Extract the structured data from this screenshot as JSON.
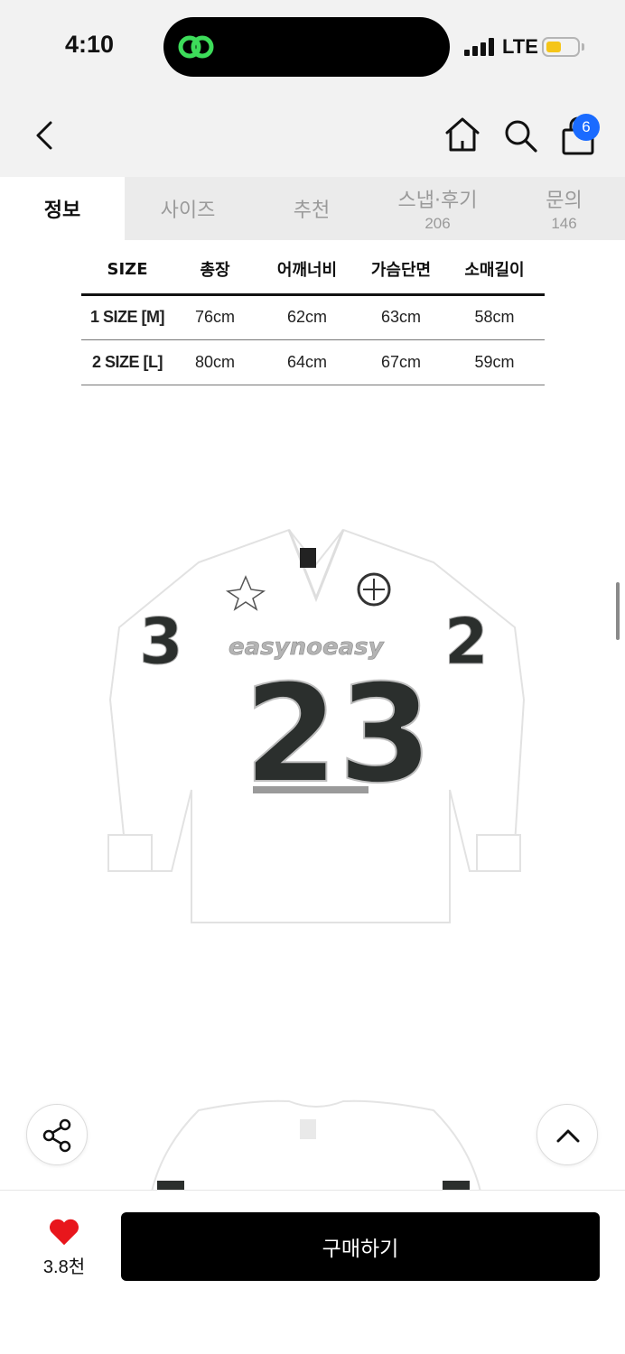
{
  "status_bar": {
    "time": "4:10",
    "network": "LTE",
    "island_icon": "link-icon",
    "battery_level": 0.45
  },
  "header": {
    "icons": [
      "chevron-left-icon",
      "home-icon",
      "search-icon",
      "bag-icon"
    ],
    "cart_count": "6"
  },
  "tabs": [
    {
      "label": "정보",
      "count": ""
    },
    {
      "label": "사이즈",
      "count": ""
    },
    {
      "label": "추천",
      "count": ""
    },
    {
      "label": "스냅·후기",
      "count": "206"
    },
    {
      "label": "문의",
      "count": "146"
    }
  ],
  "size_table": {
    "headers": [
      "SIZE",
      "총장",
      "어깨너비",
      "가슴단면",
      "소매길이"
    ],
    "rows": [
      [
        "1 SIZE [M]",
        "76cm",
        "62cm",
        "63cm",
        "58cm"
      ],
      [
        "2 SIZE [L]",
        "80cm",
        "64cm",
        "67cm",
        "59cm"
      ]
    ]
  },
  "product": {
    "jersey_text": "easynoeasy",
    "jersey_number": "23"
  },
  "actions": {
    "like_count": "3.8천",
    "buy_label": "구매하기"
  },
  "colors": {
    "accent": "#1a6bff",
    "heart": "#e8161c",
    "battery": "#f5c518",
    "island_icon": "#3ddc5a"
  }
}
